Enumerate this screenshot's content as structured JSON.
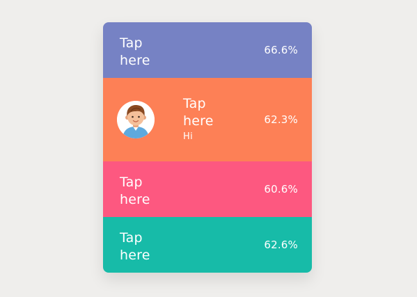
{
  "colors": {
    "background": "#efeeec",
    "row1": "#7682c4",
    "row2": "#fd8056",
    "row3": "#fd5880",
    "row4": "#17bba8"
  },
  "rows": [
    {
      "label": "Tap here",
      "percent": "66.6%"
    },
    {
      "label": "Tap here",
      "subtext": "Hi",
      "percent": "62.3%",
      "avatar_icon": "boy-avatar-icon"
    },
    {
      "label": "Tap here",
      "percent": "60.6%"
    },
    {
      "label": "Tap here",
      "percent": "62.6%"
    }
  ]
}
